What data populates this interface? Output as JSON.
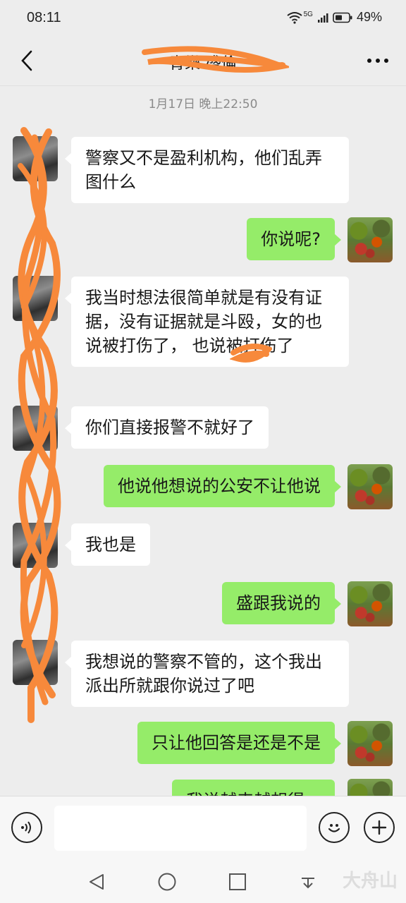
{
  "status_bar": {
    "time": "08:11",
    "network": "5G",
    "battery": "49%"
  },
  "header": {
    "title": "青樂-盛倫"
  },
  "chat": {
    "timestamp": "1月17日 晚上22:50",
    "messages": [
      {
        "side": "in",
        "text": "警察又不是盈利机构，他们乱弄图什么"
      },
      {
        "side": "out",
        "text": "你说呢?"
      },
      {
        "side": "in",
        "text": "我当时想法很简单就是有没有证据，没有证据就是斗殴，女的也说被打伤了，        也说被打伤了"
      },
      {
        "side": "in",
        "text": "你们直接报警不就好了"
      },
      {
        "side": "out",
        "text": "他说他想说的公安不让他说"
      },
      {
        "side": "in",
        "text": "我也是"
      },
      {
        "side": "out",
        "text": "盛跟我说的"
      },
      {
        "side": "in",
        "text": "我想说的警察不管的，这个我出派出所就跟你说过了吧"
      },
      {
        "side": "out",
        "text": "只让他回答是还是不是"
      },
      {
        "side": "out",
        "text": "我说越来越想得..."
      }
    ]
  },
  "input_bar": {
    "placeholder": ""
  },
  "watermark": "大舟山",
  "colors": {
    "background": "#ededed",
    "outgoing_bubble": "#95ec69",
    "incoming_bubble": "#ffffff",
    "redaction": "#f7893b"
  },
  "icons": {
    "back": "chevron-left-icon",
    "more": "more-dots-icon",
    "voice": "voice-icon",
    "emoji": "emoji-icon",
    "plus": "plus-icon",
    "nav_back": "nav-back-icon",
    "nav_home": "nav-home-icon",
    "nav_recent": "nav-recent-icon",
    "nav_notify": "nav-notify-icon"
  }
}
